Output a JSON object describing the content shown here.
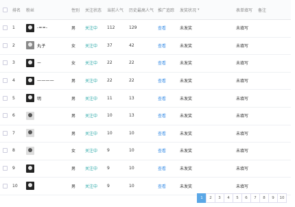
{
  "table": {
    "headers": [
      "排名",
      "粉丝",
      "性别",
      "关注状态",
      "当前人气",
      "历史最高人气",
      "推广追踪",
      "发奖状况",
      "表单填写",
      "备注"
    ],
    "rows": [
      {
        "rank": "1",
        "nick": "-==-",
        "gender": "男",
        "status": "关注中",
        "cur": "112",
        "max": "129",
        "track": "查看",
        "award": "未发奖",
        "form": "未填写",
        "avatar": "dark"
      },
      {
        "rank": "2",
        "nick": "丸子",
        "gender": "女",
        "status": "关注中",
        "cur": "37",
        "max": "42",
        "track": "查看",
        "award": "未发奖",
        "form": "未填写",
        "avatar": "mid"
      },
      {
        "rank": "3",
        "nick": "ー",
        "gender": "女",
        "status": "关注中",
        "cur": "22",
        "max": "22",
        "track": "查看",
        "award": "未发奖",
        "form": "未填写",
        "avatar": "dark"
      },
      {
        "rank": "4",
        "nick": "一一一一",
        "gender": "男",
        "status": "关注中",
        "cur": "22",
        "max": "22",
        "track": "查看",
        "award": "未发奖",
        "form": "未填写",
        "avatar": "dark"
      },
      {
        "rank": "5",
        "nick": "明",
        "gender": "男",
        "status": "关注中",
        "cur": "11",
        "max": "13",
        "track": "查看",
        "award": "未发奖",
        "form": "未填写",
        "avatar": "dark"
      },
      {
        "rank": "6",
        "nick": "",
        "gender": "男",
        "status": "关注中",
        "cur": "10",
        "max": "13",
        "track": "查看",
        "award": "未发奖",
        "form": "未填写",
        "avatar": "light"
      },
      {
        "rank": "7",
        "nick": "",
        "gender": "男",
        "status": "关注中",
        "cur": "10",
        "max": "10",
        "track": "查看",
        "award": "未发奖",
        "form": "未填写",
        "avatar": "light"
      },
      {
        "rank": "8",
        "nick": "",
        "gender": "女",
        "status": "关注中",
        "cur": "9",
        "max": "10",
        "track": "查看",
        "award": "未发奖",
        "form": "未填写",
        "avatar": "light"
      },
      {
        "rank": "9",
        "nick": "",
        "gender": "男",
        "status": "关注中",
        "cur": "9",
        "max": "10",
        "track": "查看",
        "award": "未发奖",
        "form": "未填写",
        "avatar": "dark"
      },
      {
        "rank": "10",
        "nick": "",
        "gender": "男",
        "status": "关注中",
        "cur": "9",
        "max": "10",
        "track": "查看",
        "award": "未发奖",
        "form": "未填写",
        "avatar": "dark"
      }
    ]
  },
  "pagination": {
    "pages": [
      "1",
      "2",
      "3",
      "4",
      "5",
      "6",
      "7",
      "8",
      "9",
      "10"
    ],
    "active": "1"
  },
  "colors": {
    "status": "#2aa8a8",
    "link": "#3a8ee6",
    "pager_active": "#5aa7e6"
  }
}
